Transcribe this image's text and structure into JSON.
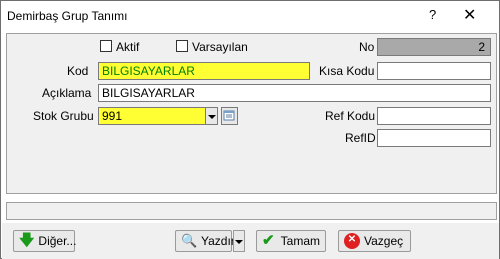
{
  "window": {
    "title": "Demirbaş Grup Tanımı",
    "help_label": "?",
    "close_label": "✕"
  },
  "form": {
    "aktif_label": "Aktif",
    "varsayilan_label": "Varsayılan",
    "no_label": "No",
    "no_value": "2",
    "kod_label": "Kod",
    "kod_label_ul": "u",
    "kod_value": "BILGISAYARLAR",
    "kisa_kod_label": "Kısa Kodu",
    "kisa_kod_value": "",
    "aciklama_label": "Açıklama",
    "aciklama_value": "BILGISAYARLAR",
    "stok_grubu_label": "Stok Grubu",
    "stok_grubu_value": "991",
    "ref_kodu_label": "Ref Kodu",
    "ref_kodu_value": "",
    "refid_label": "RefID",
    "refid_value": ""
  },
  "buttons": {
    "diger": "Diğer...",
    "yazdir": "Yazdır",
    "tamam": "Tamam",
    "vazgec": "Vazgeç"
  },
  "colors": {
    "required_field": "#ffff33",
    "code_text": "#008000",
    "readonly_field": "#a9a9a9"
  }
}
